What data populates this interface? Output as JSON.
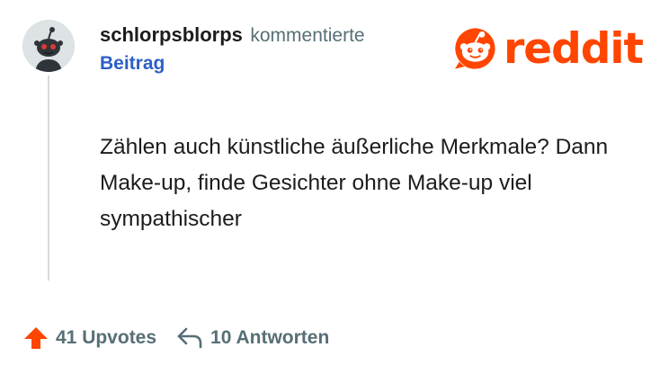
{
  "comment": {
    "author": "schlorpsblorps",
    "verb": "kommentierte",
    "post_link": "Beitrag",
    "text": "Zählen auch künstliche äußerliche Merkmale? Dann Make-up, finde Gesichter ohne Make-up viel sympathischer"
  },
  "brand": {
    "name": "reddit",
    "color": "#ff4500"
  },
  "actions": {
    "upvotes": "41 Upvotes",
    "replies": "10 Antworten"
  },
  "icons": {
    "upvote": "upvote-arrow-icon",
    "reply": "reply-arrow-icon",
    "logo": "reddit-snoo-icon"
  },
  "colors": {
    "author": "#1c1c1c",
    "link": "#2c5fc7",
    "muted": "#576f76",
    "upvote": "#ff4500"
  }
}
